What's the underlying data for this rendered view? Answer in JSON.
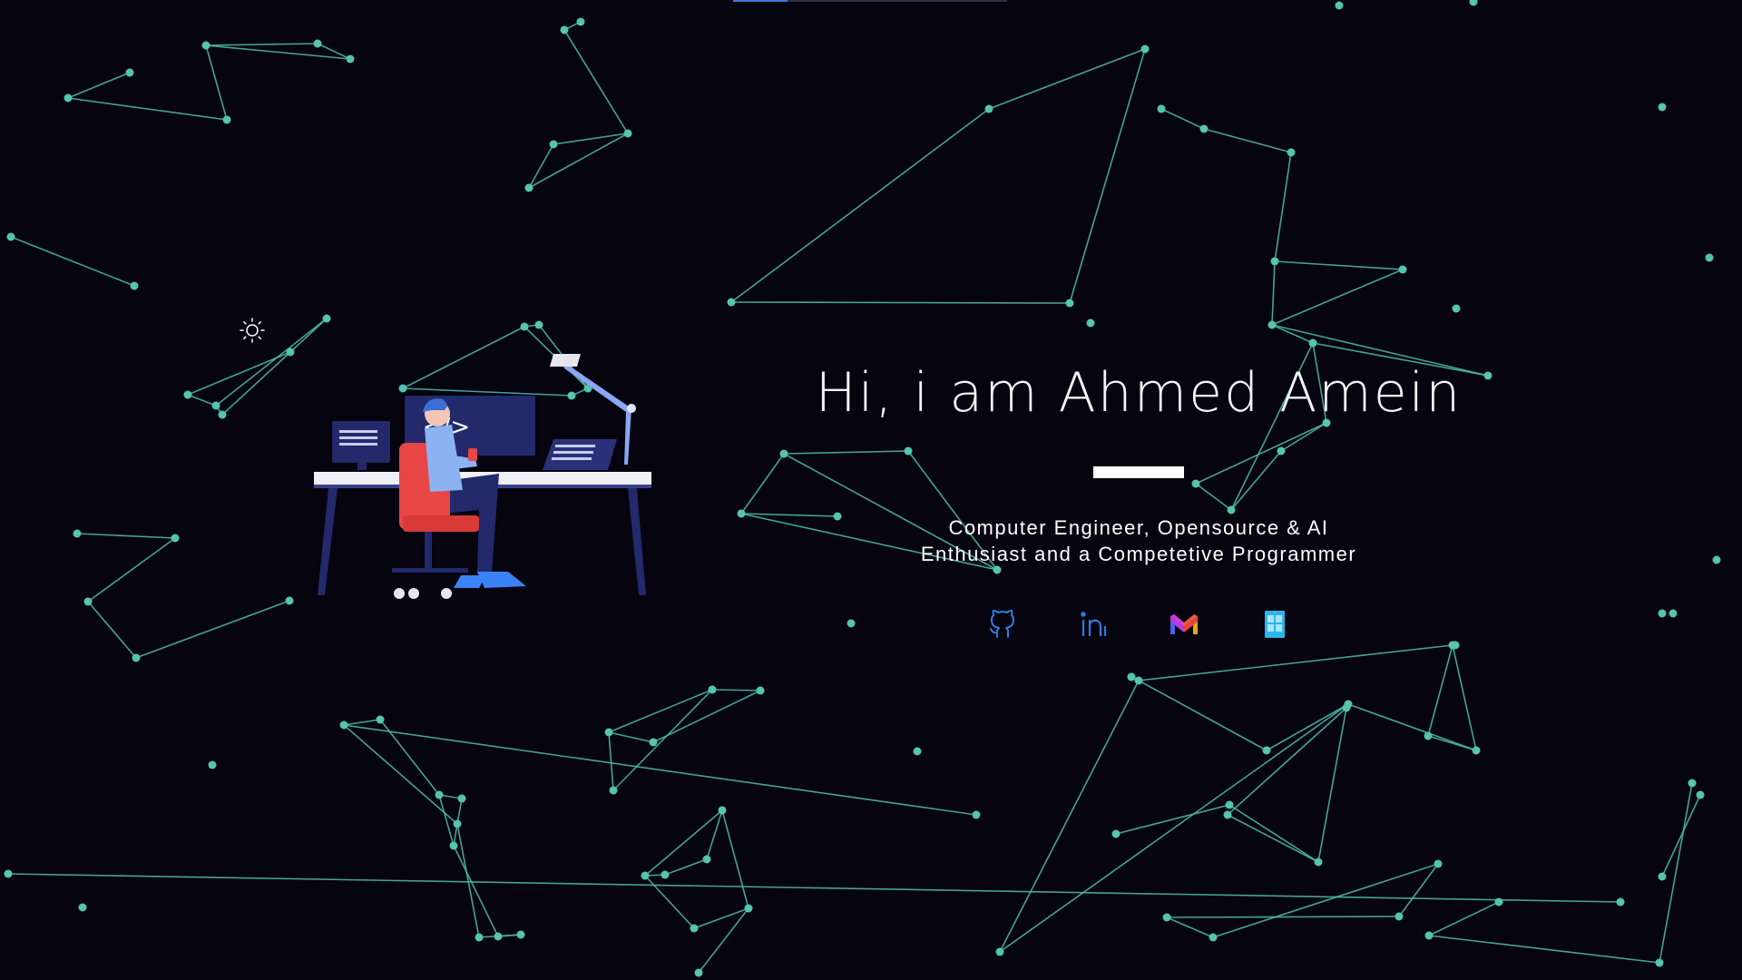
{
  "hero": {
    "title": "Hi, i am Ahmed Amein",
    "tagline_line1": "Computer Engineer, Opensource & AI",
    "tagline_line2": "Enthusiast and a Competetive Programmer"
  },
  "theme_toggle": {
    "icon": "sun-icon"
  },
  "illustration": {
    "code_symbol": "</>"
  },
  "socials": [
    {
      "name": "GitHub",
      "icon": "github-icon",
      "color": "#2f7de1"
    },
    {
      "name": "LinkedIn",
      "icon": "linkedin-icon",
      "color": "#2f7de1"
    },
    {
      "name": "Gmail",
      "icon": "gmail-icon",
      "color": "#e8453c"
    },
    {
      "name": "Resume",
      "icon": "document-icon",
      "color": "#2fb6e8"
    }
  ],
  "colors": {
    "background": "#05040f",
    "particle": "#55c4b0",
    "accent": "#3b7bd6"
  }
}
